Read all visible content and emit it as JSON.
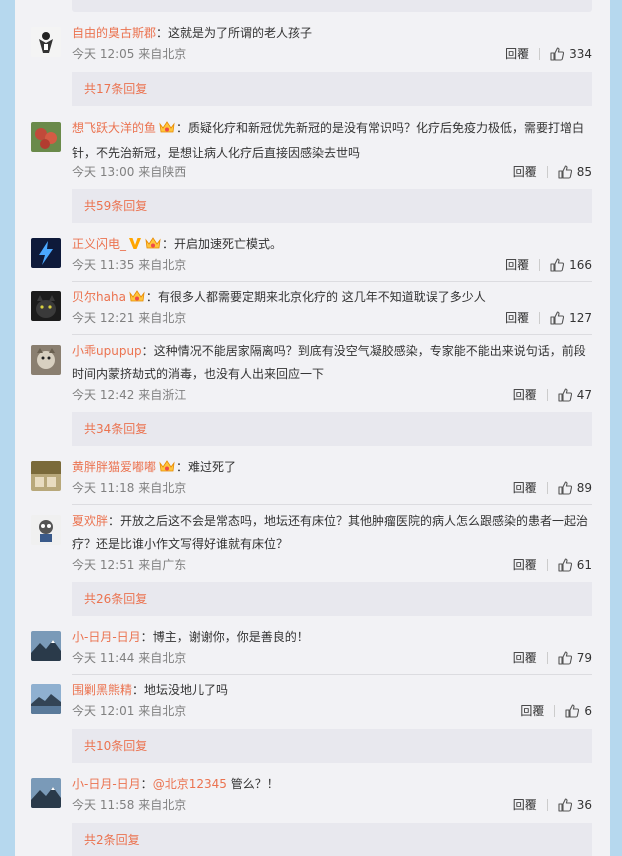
{
  "ui": {
    "reply_label": "回覆"
  },
  "comments": [
    {
      "user": "自由的臭古斯郡",
      "badges": [],
      "body": "这就是为了所谓的老人孩子",
      "time": "今天 12:05 来自北京",
      "likes": "334",
      "more": "共17条回复"
    },
    {
      "user": "想飞跃大洋的鱼",
      "badges": [
        "crown"
      ],
      "body": "质疑化疗和新冠优先新冠的是没有常识吗？化疗后免疫力极低，需要打增白针，不先治新冠，是想让病人化疗后直接因感染去世吗",
      "time": "今天 13:00 来自陕西",
      "likes": "85",
      "more": "共59条回复"
    },
    {
      "user": "正义闪电_",
      "badges": [
        "v",
        "crown"
      ],
      "body": "开启加速死亡模式。",
      "time": "今天 11:35 来自北京",
      "likes": "166",
      "more": ""
    },
    {
      "user": "贝尔haha",
      "badges": [
        "crown"
      ],
      "body": "有很多人都需要定期来北京化疗的 这几年不知道耽误了多少人",
      "time": "今天 12:21 来自北京",
      "likes": "127",
      "more": ""
    },
    {
      "user": "小乖upupup",
      "badges": [],
      "body": "这种情况不能居家隔离吗？到底有没空气凝胶感染，专家能不能出来说句话，前段时间内蒙挤劫式的消毒，也没有人出来回应一下",
      "time": "今天 12:42 来自浙江",
      "likes": "47",
      "more": "共34条回复"
    },
    {
      "user": "黄胖胖猫爱嘟嘟",
      "badges": [
        "crown"
      ],
      "body": "难过死了",
      "time": "今天 11:18 来自北京",
      "likes": "89",
      "more": ""
    },
    {
      "user": "夏欢胖",
      "badges": [],
      "body": "开放之后这不会是常态吗，地坛还有床位？其他肿瘤医院的病人怎么跟感染的患者一起治疗？还是比谁小作文写得好谁就有床位？",
      "time": "今天 12:51 来自广东",
      "likes": "61",
      "more": "共26条回复"
    },
    {
      "user": "小-日月-日月",
      "badges": [],
      "body": "博主，谢谢你，你是善良的！",
      "time": "今天 11:44 来自北京",
      "likes": "79",
      "more": ""
    },
    {
      "user": "围剿黑熊精",
      "badges": [],
      "body": "地坛没地儿了吗",
      "time": "今天 12:01 来自北京",
      "likes": "6",
      "more": "共10条回复"
    },
    {
      "user": "小-日月-日月",
      "badges": [],
      "mention": "@北京12345",
      "body": " 管么？！",
      "time": "今天 11:58 来自北京",
      "likes": "36",
      "more": "共2条回复"
    }
  ]
}
